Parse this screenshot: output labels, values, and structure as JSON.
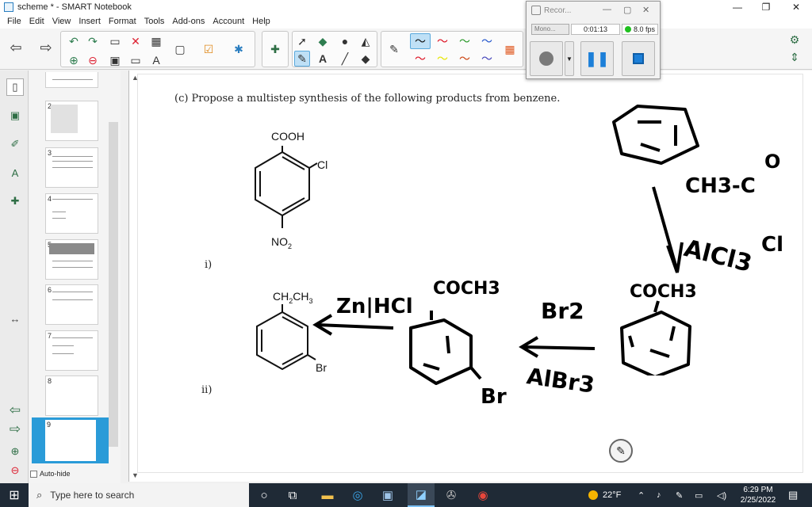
{
  "window": {
    "title": "scheme * - SMART Notebook",
    "minimize": "—",
    "maximize": "❐",
    "close": "✕"
  },
  "menu": [
    "File",
    "Edit",
    "View",
    "Insert",
    "Format",
    "Tools",
    "Add-ons",
    "Account",
    "Help"
  ],
  "slides": {
    "numbers": [
      "2",
      "3",
      "4",
      "5",
      "6",
      "7",
      "8",
      "9"
    ],
    "active": "9",
    "autohide_label": "Auto-hide"
  },
  "page": {
    "question": "(c)  Propose a multistep synthesis of the following products from benzene.",
    "label_i": "i)",
    "label_ii": "ii)",
    "compound_i": {
      "top": "COOH",
      "side": "Cl",
      "bottom": "NO",
      "bottom_sub": "2"
    },
    "compound_ii": {
      "top": "CH",
      "top_sub1": "2",
      "top_mid": "CH",
      "top_sub2": "3",
      "side": "Br"
    },
    "handwriting": {
      "reagent1": "CH3-C",
      "oxygen": "O",
      "chloride": "Cl",
      "lewis_acid": "AlCl3",
      "acetyl_top": "COCH3",
      "bromine": "Br2",
      "febr": "AlBr3",
      "acetyl_mid": "COCH3",
      "br_sub": "Br",
      "reduction": "Zn|HCl"
    }
  },
  "recorder": {
    "title": "Recor...",
    "mode": "Mono...",
    "time": "0:01:13",
    "fps": "8.0 fps"
  },
  "taskbar": {
    "search_placeholder": "Type here to search",
    "weather": "22°F",
    "time": "6:29 PM",
    "date": "2/25/2022"
  },
  "colors": {
    "accent": "#2a9bd8",
    "taskbar": "#1f2a36",
    "rec_green": "#1ec01e"
  }
}
